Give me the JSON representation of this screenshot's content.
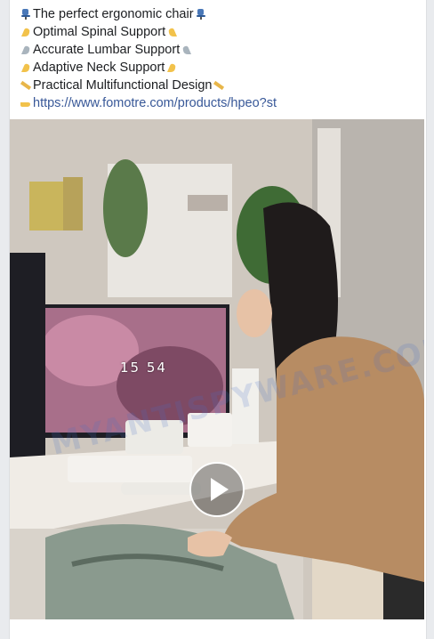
{
  "post": {
    "lines": [
      {
        "emoji_start": "seat-icon",
        "text": "The perfect ergonomic chair",
        "emoji_end": "seat-icon"
      },
      {
        "emoji_start": "flexed-biceps-icon",
        "text": "Optimal Spinal Support",
        "emoji_end": "flexed-biceps-icon"
      },
      {
        "emoji_start": "mechanical-arm-icon",
        "text": "Accurate Lumbar Support",
        "emoji_end": "mechanical-arm-icon"
      },
      {
        "emoji_start": "flexed-biceps-icon",
        "text": "Adaptive Neck Support",
        "emoji_end": "flexed-biceps-icon"
      },
      {
        "emoji_start": "ruler-icon",
        "text": "Practical Multifunctional Design",
        "emoji_end": "ruler-icon"
      }
    ],
    "link": {
      "icon": "pointing-hand-icon",
      "text": "https://www.fomotre.com/products/hpeo?st"
    }
  },
  "video": {
    "clock_text": "15 54",
    "watermark_text": "MYANTISPYWARE.COM",
    "play_icon": "play-icon"
  },
  "colors": {
    "link": "#385898",
    "text": "#1c1e21",
    "chair_blue": "#4a78b8",
    "biceps": "#f2c24b"
  }
}
